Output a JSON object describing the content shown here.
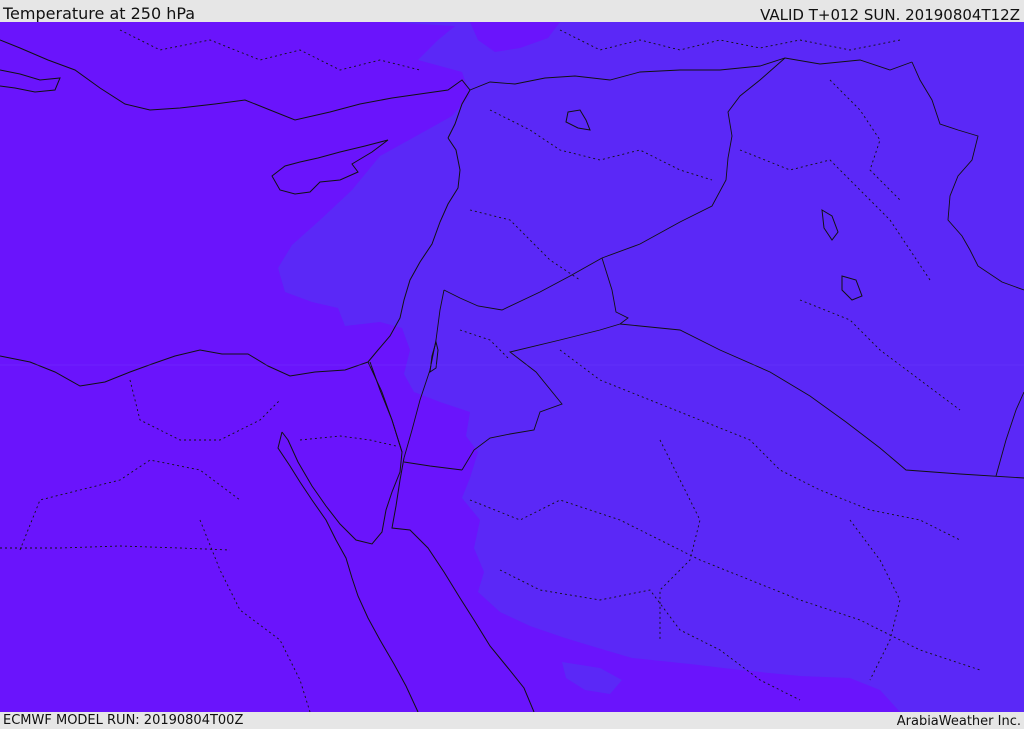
{
  "header": {
    "title": "Temperature at 250 hPa",
    "valid_time": "VALID T+012 SUN. 20190804T12Z"
  },
  "footer": {
    "model_run": "ECMWF MODEL RUN: 20190804T00Z",
    "credit": "ArabiaWeather Inc."
  },
  "map": {
    "colors": {
      "cold_field": "#6a14fc",
      "warm_field": "#5b28f7",
      "coastline": "#111111",
      "border": "#111111"
    }
  }
}
